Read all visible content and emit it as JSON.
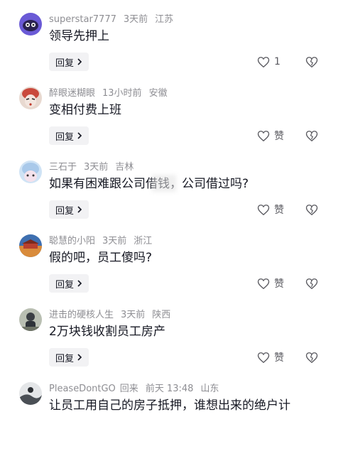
{
  "ui": {
    "reply_label": "回复",
    "like_placeholder": "赞"
  },
  "comments": [
    {
      "username": "superstar7777",
      "time": "3天前",
      "location": "江苏",
      "text": "领导先押上",
      "likes": "1",
      "avatar_color": "#6a5ad6"
    },
    {
      "username": "醉眼迷糊眼",
      "time": "13小时前",
      "location": "安徽",
      "text": "变相付费上班",
      "likes": "赞",
      "avatar_color": "#c94a3d"
    },
    {
      "username": "三石于",
      "time": "3天前",
      "location": "吉林",
      "text": "如果有困难跟公司借钱，公司借过吗?",
      "likes": "赞",
      "avatar_color": "#a9c9ea"
    },
    {
      "username": "聪慧的小阳",
      "time": "3天前",
      "location": "浙江",
      "text": "假的吧，员工傻吗?",
      "likes": "赞",
      "avatar_color": "#d98b3b"
    },
    {
      "username": "进击的硬核人生",
      "time": "3天前",
      "location": "陕西",
      "text": "2万块钱收割员工房产",
      "likes": "赞",
      "avatar_color": "#6e7466"
    },
    {
      "username": "PleaseDontGO",
      "reply_tag": "回来",
      "time": "前天 13:48",
      "location": "山东",
      "text": "让员工用自己的房子抵押，谁想出来的绝户计",
      "likes": "",
      "avatar_color": "#4a4f55"
    }
  ]
}
